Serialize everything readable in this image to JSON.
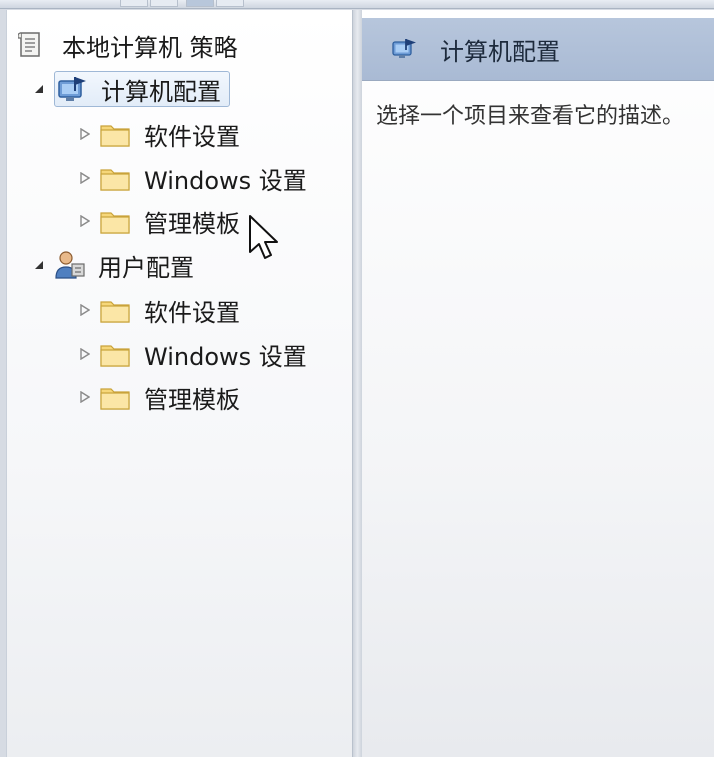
{
  "tree": {
    "root": {
      "label": "本地计算机 策略",
      "icon": "policy-document-icon"
    },
    "computer_config": {
      "label": "计算机配置",
      "icon": "computer-config-icon",
      "children": [
        {
          "label": "软件设置",
          "icon": "folder-icon"
        },
        {
          "label": "Windows 设置",
          "icon": "folder-icon"
        },
        {
          "label": "管理模板",
          "icon": "folder-icon"
        }
      ]
    },
    "user_config": {
      "label": "用户配置",
      "icon": "user-config-icon",
      "children": [
        {
          "label": "软件设置",
          "icon": "folder-icon"
        },
        {
          "label": "Windows 设置",
          "icon": "folder-icon"
        },
        {
          "label": "管理模板",
          "icon": "folder-icon"
        }
      ]
    }
  },
  "details": {
    "header_title": "计算机配置",
    "header_icon": "computer-config-icon",
    "description": "选择一个项目来查看它的描述。"
  },
  "colors": {
    "header_bg": "#b0c0d8",
    "folder_fill": "#f6d77a",
    "selection_border": "#9fb8d6"
  }
}
